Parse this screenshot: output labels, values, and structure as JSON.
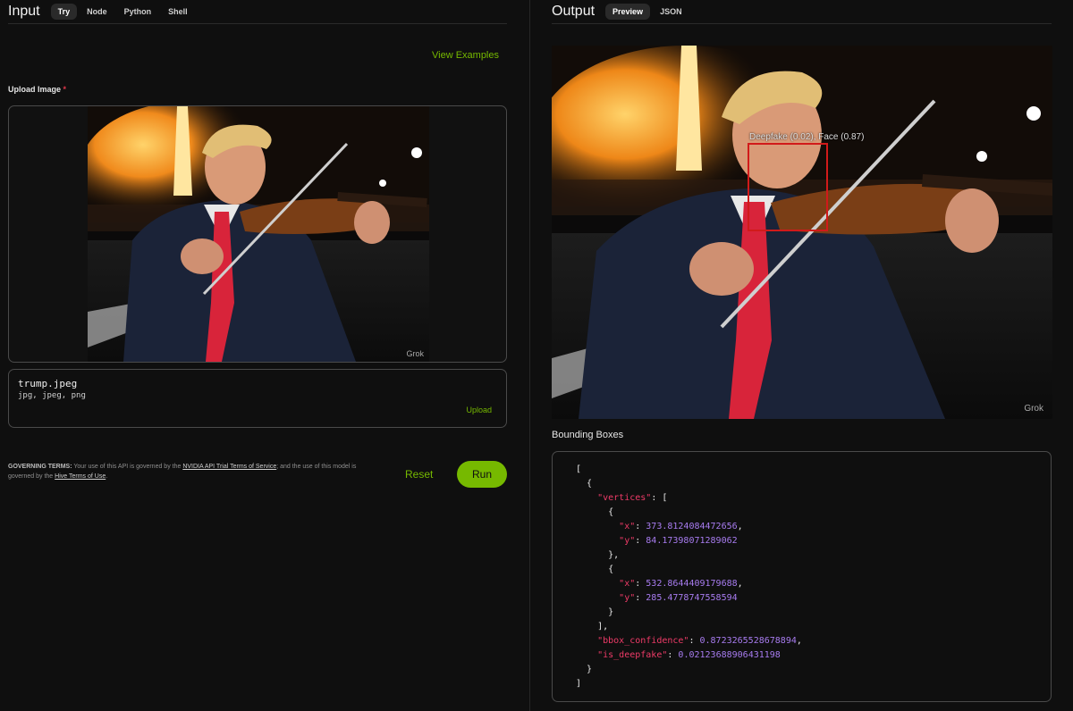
{
  "input": {
    "title": "Input",
    "tabs": [
      "Try",
      "Node",
      "Python",
      "Shell"
    ],
    "view_examples": "View Examples",
    "upload_label": "Upload Image",
    "required_mark": "*",
    "file_name": "trump.jpeg",
    "file_types": "jpg, jpeg, png",
    "upload_button": "Upload",
    "watermark": "Grok",
    "terms": {
      "heading": "GOVERNING TERMS:",
      "text1": " Your use of this API is governed by the ",
      "link1": "NVIDIA API Trial Terms of Service",
      "text2": "; and the use of this model is governed by the ",
      "link2": "Hive Terms of Use",
      "text3": "."
    },
    "reset_button": "Reset",
    "run_button": "Run"
  },
  "output": {
    "title": "Output",
    "tabs": [
      "Preview",
      "JSON"
    ],
    "bbox_label": "Deepfake (0.02), Face (0.87)",
    "watermark": "Grok",
    "bounding_boxes_title": "Bounding Boxes",
    "json_lines": [
      {
        "i": 0,
        "t": "["
      },
      {
        "i": 1,
        "t": "{"
      },
      {
        "i": 2,
        "k": "vertices",
        "t": ": ["
      },
      {
        "i": 3,
        "t": "{"
      },
      {
        "i": 4,
        "k": "x",
        "t": ": ",
        "n": "373.8124084472656",
        "e": ","
      },
      {
        "i": 4,
        "k": "y",
        "t": ": ",
        "n": "84.17398071289062"
      },
      {
        "i": 3,
        "t": "},"
      },
      {
        "i": 3,
        "t": "{"
      },
      {
        "i": 4,
        "k": "x",
        "t": ": ",
        "n": "532.8644409179688",
        "e": ","
      },
      {
        "i": 4,
        "k": "y",
        "t": ": ",
        "n": "285.4778747558594"
      },
      {
        "i": 3,
        "t": "}"
      },
      {
        "i": 2,
        "t": "],"
      },
      {
        "i": 2,
        "k": "bbox_confidence",
        "t": ": ",
        "n": "0.8723265528678894",
        "e": ","
      },
      {
        "i": 2,
        "k": "is_deepfake",
        "t": ": ",
        "n": "0.02123688906431198"
      },
      {
        "i": 1,
        "t": "}"
      },
      {
        "i": 0,
        "t": "]"
      }
    ]
  },
  "colors": {
    "accent": "#76b900",
    "bbox": "#d11a1a",
    "json_key": "#ef3b68",
    "json_number": "#a87cf0"
  }
}
